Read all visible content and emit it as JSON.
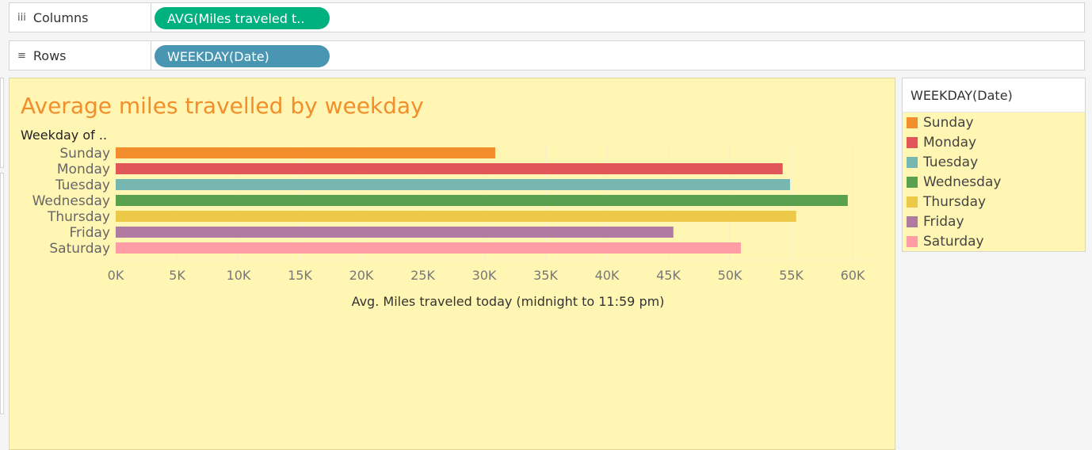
{
  "shelves": {
    "columns": {
      "label": "Columns",
      "icon": "iii",
      "pill": "AVG(Miles traveled t..",
      "pill_color": "#00b180"
    },
    "rows": {
      "label": "Rows",
      "icon": "≡",
      "pill": "WEEKDAY(Date)",
      "pill_color": "#4996b2"
    }
  },
  "view": {
    "background": "#fff6b3",
    "row_header": "Weekday of .."
  },
  "legend": {
    "title": "WEEKDAY(Date)",
    "items": [
      {
        "label": "Sunday",
        "color": "#f28e2b"
      },
      {
        "label": "Monday",
        "color": "#e15759"
      },
      {
        "label": "Tuesday",
        "color": "#76b7b2"
      },
      {
        "label": "Wednesday",
        "color": "#59a14f"
      },
      {
        "label": "Thursday",
        "color": "#edc948"
      },
      {
        "label": "Friday",
        "color": "#b07aa1"
      },
      {
        "label": "Saturday",
        "color": "#ff9da7"
      }
    ]
  },
  "chart_data": {
    "type": "bar",
    "orientation": "horizontal",
    "title": "Average miles travelled by weekday",
    "xlabel": "Avg. Miles traveled today (midnight to 11:59 pm)",
    "ylabel": "Weekday of ..",
    "categories": [
      "Sunday",
      "Monday",
      "Tuesday",
      "Wednesday",
      "Thursday",
      "Friday",
      "Saturday"
    ],
    "values": [
      30900,
      54300,
      54900,
      59600,
      55400,
      45400,
      50900
    ],
    "colors": [
      "#f28e2b",
      "#e15759",
      "#76b7b2",
      "#59a14f",
      "#edc948",
      "#b07aa1",
      "#ff9da7"
    ],
    "xlim": [
      0,
      60000
    ],
    "xticks": [
      0,
      5000,
      10000,
      15000,
      20000,
      25000,
      30000,
      35000,
      40000,
      45000,
      50000,
      55000,
      60000
    ],
    "xtick_labels": [
      "0K",
      "5K",
      "10K",
      "15K",
      "20K",
      "25K",
      "30K",
      "35K",
      "40K",
      "45K",
      "50K",
      "55K",
      "60K"
    ],
    "grid": true
  }
}
